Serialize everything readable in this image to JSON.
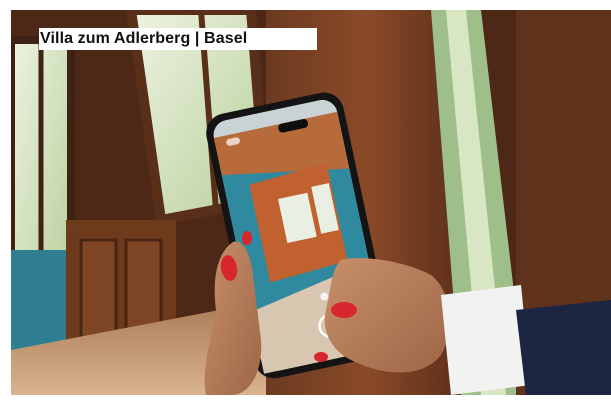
{
  "caption": {
    "title": "Villa zum Adlerberg | Basel"
  },
  "photo": {
    "subject": "hands-holding-smartphone-scanning-room",
    "colors": {
      "wood_dark": "#5a2f1a",
      "wood_mid": "#8a4a28",
      "window_light": "#d9e6c4",
      "teal_wall": "#2f8aa0",
      "nail_polish": "#d8262e",
      "sleeve_white": "#f2f2f0",
      "sleeve_navy": "#1b2440"
    }
  }
}
